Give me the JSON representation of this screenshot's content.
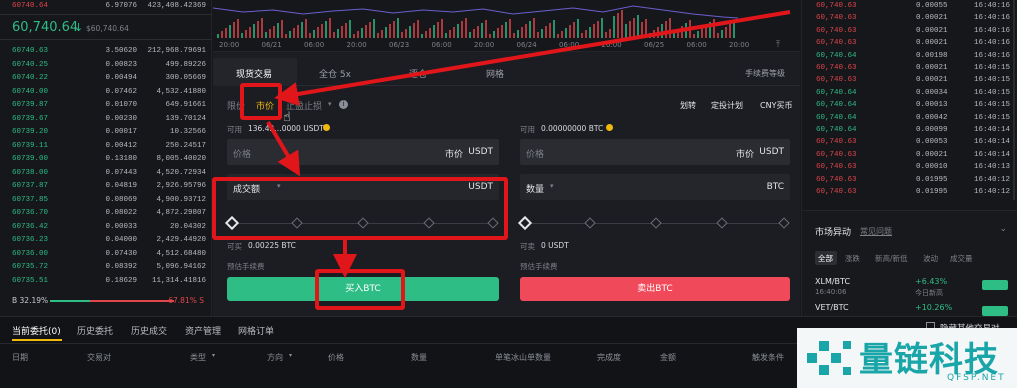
{
  "orderbook": {
    "top_row": {
      "price": "60740.64",
      "amount": "6.97076",
      "total": "423,408.42369"
    },
    "last_price": "60,740.64",
    "last_price_arrow": "↓",
    "last_usd": "$60,740.64",
    "bids": [
      {
        "price": "60740.63",
        "amount": "3.50620",
        "total": "212,968.79691"
      },
      {
        "price": "60740.25",
        "amount": "0.00823",
        "total": "499.89226"
      },
      {
        "price": "60740.22",
        "amount": "0.00494",
        "total": "300.05669"
      },
      {
        "price": "60740.00",
        "amount": "0.07462",
        "total": "4,532.41880"
      },
      {
        "price": "60739.87",
        "amount": "0.01070",
        "total": "649.91661"
      },
      {
        "price": "60739.67",
        "amount": "0.00230",
        "total": "139.70124"
      },
      {
        "price": "60739.20",
        "amount": "0.00017",
        "total": "10.32566"
      },
      {
        "price": "60739.11",
        "amount": "0.00412",
        "total": "250.24517"
      },
      {
        "price": "60739.00",
        "amount": "0.13180",
        "total": "8,005.40020"
      },
      {
        "price": "60738.00",
        "amount": "0.07443",
        "total": "4,520.72934"
      },
      {
        "price": "60737.87",
        "amount": "0.04819",
        "total": "2,926.95796"
      },
      {
        "price": "60737.85",
        "amount": "0.08069",
        "total": "4,900.93712"
      },
      {
        "price": "60736.70",
        "amount": "0.08022",
        "total": "4,872.29807"
      },
      {
        "price": "60736.42",
        "amount": "0.00033",
        "total": "20.04302"
      },
      {
        "price": "60736.23",
        "amount": "0.04000",
        "total": "2,429.44920"
      },
      {
        "price": "60736.00",
        "amount": "0.07430",
        "total": "4,512.68480"
      },
      {
        "price": "60735.72",
        "amount": "0.08392",
        "total": "5,096.94162"
      },
      {
        "price": "60735.51",
        "amount": "0.18629",
        "total": "11,314.41816"
      }
    ],
    "ratio_b": "B 32.19%",
    "ratio_s": "67.81% S",
    "buy_ratio": 0.3219
  },
  "chart": {
    "x_labels": [
      "20:00",
      "06/21",
      "06:00",
      "20:00",
      "06/23",
      "06:00",
      "20:00",
      "06/24",
      "06:00",
      "20:00",
      "06/25",
      "06:00",
      "20:00"
    ]
  },
  "form": {
    "tabs": [
      "现货交易",
      "全仓 5x",
      "逐仓",
      "网格"
    ],
    "fee_link": "手续费等级",
    "order_types": {
      "limit": "限价",
      "market": "市价",
      "stop": "止盈止损",
      "stop_arrow": "▾",
      "info": "i"
    },
    "right_links": [
      "划转",
      "定投计划",
      "CNY买币"
    ],
    "buy": {
      "avail_label": "可用",
      "avail_value": "136.42…0000 USDT",
      "price_placeholder": "价格",
      "price_mode": "市价",
      "price_unit": "USDT",
      "amount_label": "成交额",
      "amount_unit": "USDT",
      "can_buy_label": "可买",
      "can_buy_value": "0.00225 BTC",
      "fee_label": "预估手续费",
      "button": "买入BTC"
    },
    "sell": {
      "avail_label": "可用",
      "avail_value": "0.00000000 BTC",
      "price_placeholder": "价格",
      "price_mode": "市价",
      "price_unit": "USDT",
      "amount_label": "数量",
      "amount_unit": "BTC",
      "can_sell_label": "可卖",
      "can_sell_value": "0 USDT",
      "fee_label": "预估手续费",
      "button": "卖出BTC"
    }
  },
  "trades": [
    {
      "price": "60,740.63",
      "amount": "0.00055",
      "time": "16:40:16"
    },
    {
      "price": "60,740.63",
      "amount": "0.00021",
      "time": "16:40:16"
    },
    {
      "price": "60,740.63",
      "amount": "0.00021",
      "time": "16:40:16"
    },
    {
      "price": "60,740.63",
      "amount": "0.00021",
      "time": "16:40:16"
    },
    {
      "price": "60,740.64",
      "amount": "0.00198",
      "time": "16:40:16"
    },
    {
      "price": "60,740.63",
      "amount": "0.00021",
      "time": "16:40:15"
    },
    {
      "price": "60,740.63",
      "amount": "0.00021",
      "time": "16:40:15"
    },
    {
      "price": "60,740.64",
      "amount": "0.00034",
      "time": "16:40:15"
    },
    {
      "price": "60,740.64",
      "amount": "0.00013",
      "time": "16:40:15"
    },
    {
      "price": "60,740.64",
      "amount": "0.00042",
      "time": "16:40:15"
    },
    {
      "price": "60,740.64",
      "amount": "0.00099",
      "time": "16:40:14"
    },
    {
      "price": "60,740.63",
      "amount": "0.00053",
      "time": "16:40:14"
    },
    {
      "price": "60,740.63",
      "amount": "0.00021",
      "time": "16:40:14"
    },
    {
      "price": "60,740.63",
      "amount": "0.00010",
      "time": "16:40:13"
    },
    {
      "price": "60,740.63",
      "amount": "0.01995",
      "time": "16:40:12"
    },
    {
      "price": "60,740.63",
      "amount": "0.01995",
      "time": "16:40:12"
    }
  ],
  "market": {
    "title": "市场异动",
    "help": "常见问题",
    "filters": [
      "全部",
      "涨跌",
      "新高/新低",
      "波动",
      "成交量"
    ],
    "items": [
      {
        "pair": "XLM/BTC",
        "time": "16:40:06",
        "change": "+6.43%",
        "desc": "今日新高"
      },
      {
        "pair": "VET/BTC",
        "time": "",
        "change": "+10.26%",
        "desc": ""
      }
    ]
  },
  "bottom": {
    "tabs": [
      "当前委托(0)",
      "历史委托",
      "历史成交",
      "资产管理",
      "网格订单"
    ],
    "hide_label": "隐藏其他交易对",
    "columns": [
      "日期",
      "交易对",
      "类型",
      "方向",
      "价格",
      "数量",
      "单笔冰山单数量",
      "完成度",
      "金额",
      "触发条件"
    ]
  },
  "watermark": {
    "name": "量链科技",
    "url": "QFSP.NET"
  }
}
